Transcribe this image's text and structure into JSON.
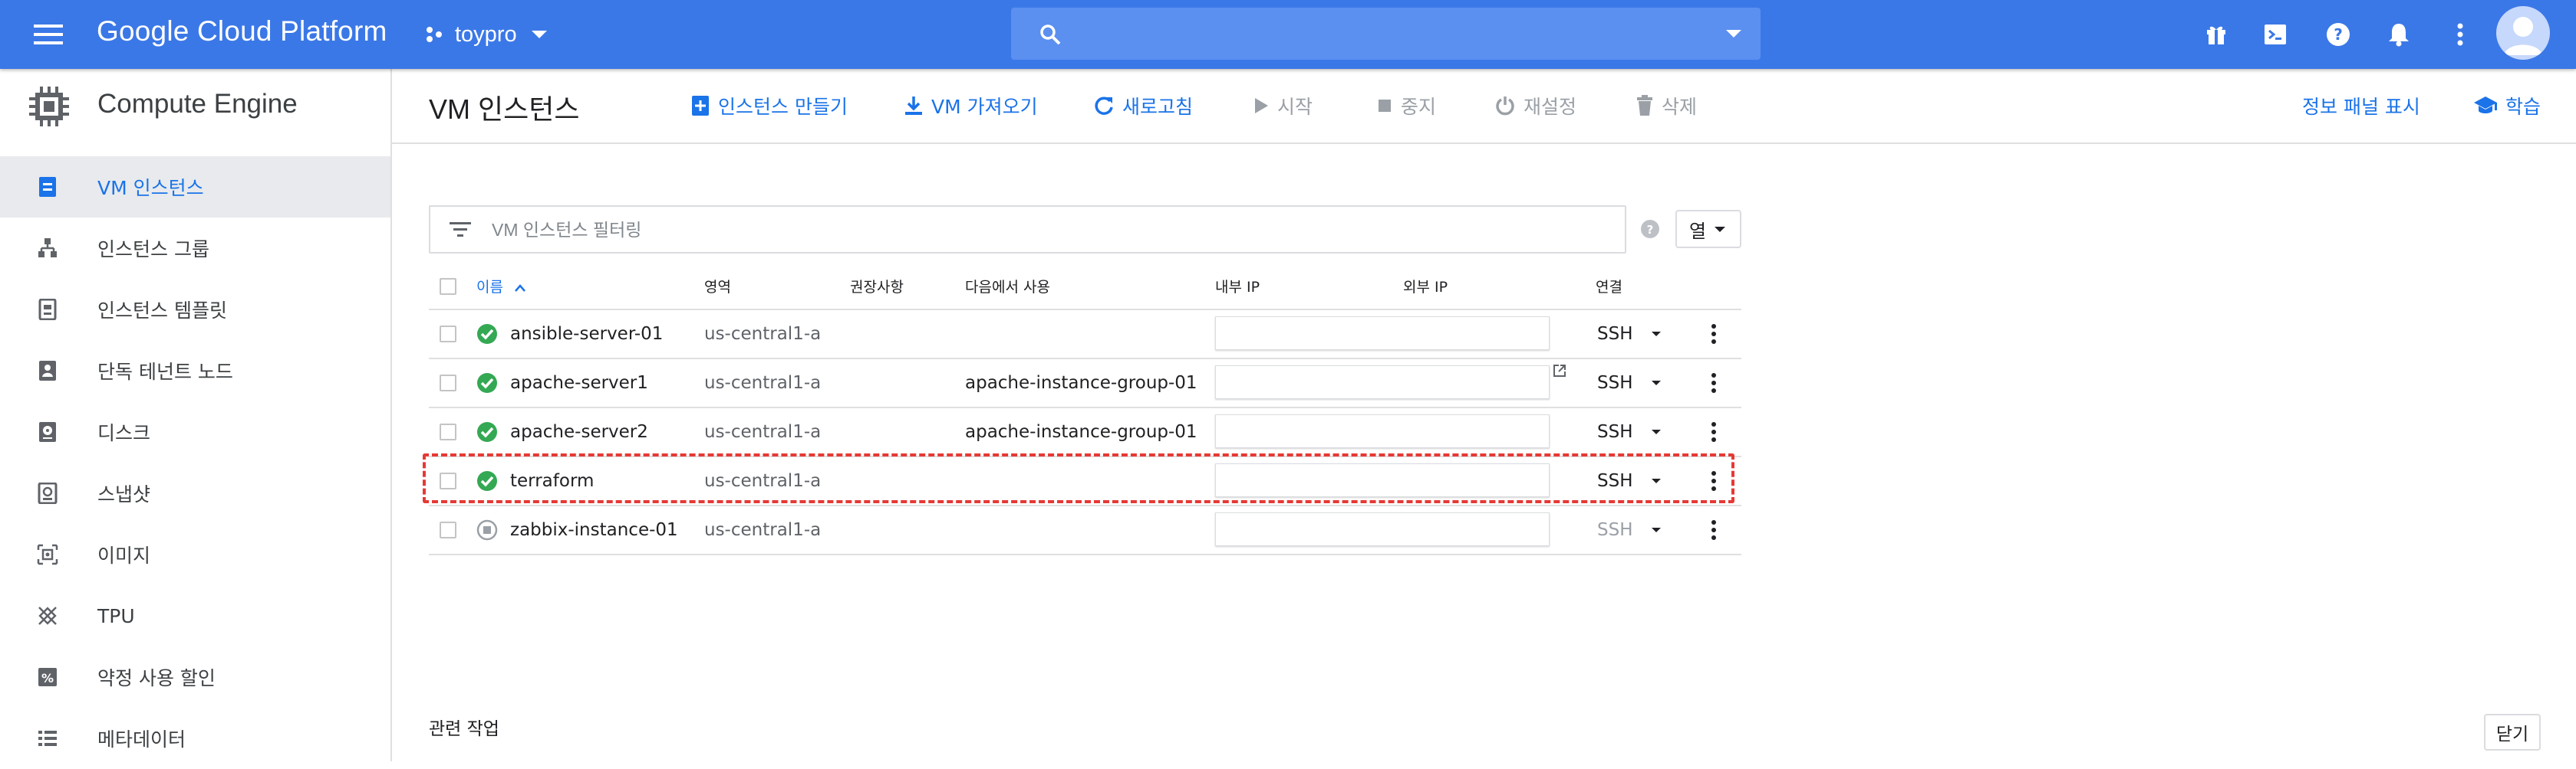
{
  "app": {
    "brand": "Google Cloud Platform",
    "project": "toypro",
    "search_placeholder": "",
    "topbar_icons": [
      "gift-icon",
      "cloud-shell-icon",
      "help-icon",
      "notifications-icon",
      "more-vert-icon",
      "avatar"
    ]
  },
  "sidebar": {
    "product_title": "Compute Engine",
    "items": [
      {
        "label": "VM 인스턴스",
        "icon": "vm-instance-icon",
        "active": true
      },
      {
        "label": "인스턴스 그룹",
        "icon": "instance-group-icon"
      },
      {
        "label": "인스턴스 템플릿",
        "icon": "instance-template-icon"
      },
      {
        "label": "단독 테넌트 노드",
        "icon": "sole-tenant-icon"
      },
      {
        "label": "디스크",
        "icon": "disk-icon"
      },
      {
        "label": "스냅샷",
        "icon": "snapshot-icon"
      },
      {
        "label": "이미지",
        "icon": "image-icon"
      },
      {
        "label": "TPU",
        "icon": "tpu-icon"
      },
      {
        "label": "약정 사용 할인",
        "icon": "discount-icon"
      },
      {
        "label": "메타데이터",
        "icon": "metadata-icon"
      }
    ]
  },
  "actionbar": {
    "title": "VM 인스턴스",
    "create": "인스턴스 만들기",
    "import": "VM 가져오기",
    "refresh": "새로고침",
    "start": "시작",
    "stop": "중지",
    "reset": "재설정",
    "delete": "삭제",
    "info_panel": "정보 패널 표시",
    "learn": "학습"
  },
  "filter": {
    "placeholder": "VM 인스턴스 필터링",
    "columns_label": "열"
  },
  "table": {
    "headers": {
      "name": "이름",
      "zone": "영역",
      "recommendation": "권장사항",
      "in_use_by": "다음에서 사용",
      "internal_ip": "내부 IP",
      "external_ip": "외부 IP",
      "connect": "연결"
    },
    "rows": [
      {
        "name": "ansible-server-01",
        "zone": "us-central1-a",
        "recommendation": "",
        "in_use_by": "",
        "connect": "SSH",
        "status": "running"
      },
      {
        "name": "apache-server1",
        "zone": "us-central1-a",
        "recommendation": "",
        "in_use_by": "apache-instance-group-01",
        "connect": "SSH",
        "status": "running"
      },
      {
        "name": "apache-server2",
        "zone": "us-central1-a",
        "recommendation": "",
        "in_use_by": "apache-instance-group-01",
        "connect": "SSH",
        "status": "running"
      },
      {
        "name": "terraform",
        "zone": "us-central1-a",
        "recommendation": "",
        "in_use_by": "",
        "connect": "SSH",
        "status": "running",
        "highlighted": true
      },
      {
        "name": "zabbix-instance-01",
        "zone": "us-central1-a",
        "recommendation": "",
        "in_use_by": "",
        "connect": "SSH",
        "status": "stopped"
      }
    ]
  },
  "footer": {
    "related": "관련 작업",
    "close": "닫기"
  },
  "colors": {
    "topbar": "#3b78e7",
    "accent": "#1a73e8",
    "running": "#34a853",
    "highlight": "#e53935"
  }
}
